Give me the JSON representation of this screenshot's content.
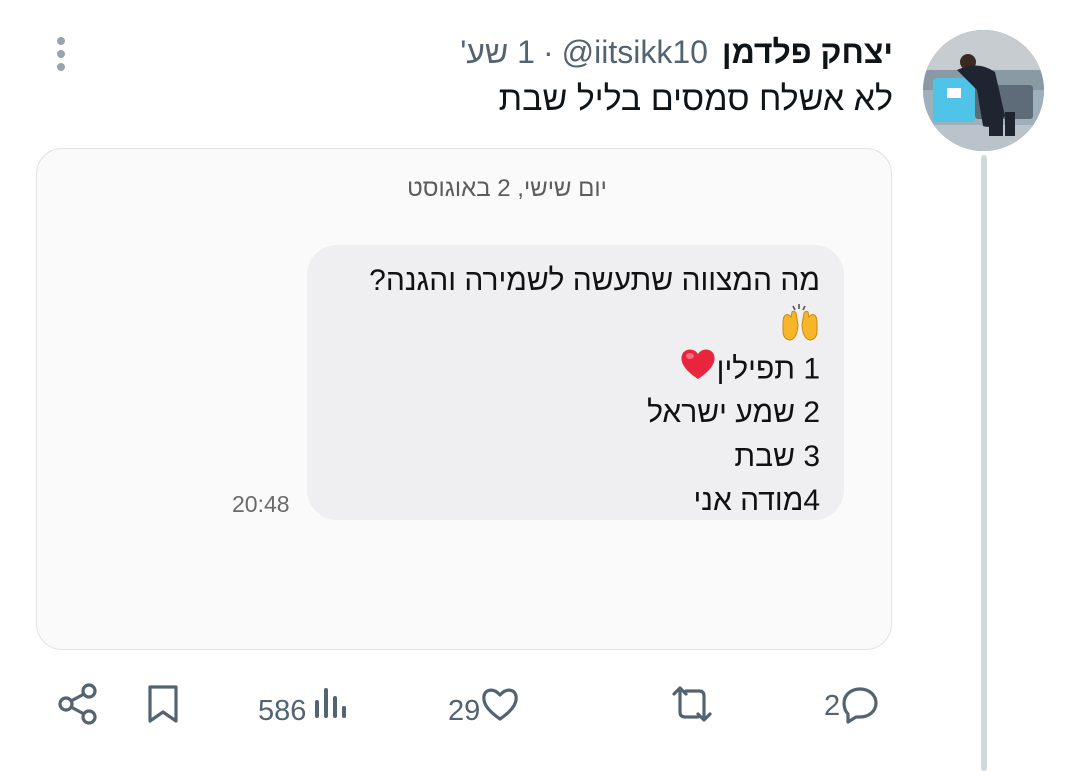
{
  "tweet": {
    "author_name": "יצחק פלדמן",
    "handle": "@iitsikk10",
    "separator": "·",
    "time_ago": "1 שע'",
    "text": "לא אשלח סמסים בליל שבת"
  },
  "embedded_image": {
    "date_header": "יום שישי, 2 באוגוסט",
    "message_lines": [
      "מה המצווה שתעשה לשמירה והגנה?",
      "1 תפילין",
      "2 שמע ישראל",
      "3 שבת",
      "4מודה אני"
    ],
    "timestamp": "20:48"
  },
  "actions": {
    "replies": "2",
    "likes": "29",
    "views": "586"
  },
  "icons": {
    "more": "more-vertical-icon",
    "reply": "reply-icon",
    "retweet": "retweet-icon",
    "like": "heart-icon",
    "views": "views-icon",
    "bookmark": "bookmark-icon",
    "share": "share-icon",
    "raised_hands": "raised-hands-emoji",
    "heart_emoji": "red-heart-emoji"
  },
  "colors": {
    "icon_gray": "#536471",
    "thread_line": "#cfd9de",
    "heart_red": "#e8253d"
  }
}
